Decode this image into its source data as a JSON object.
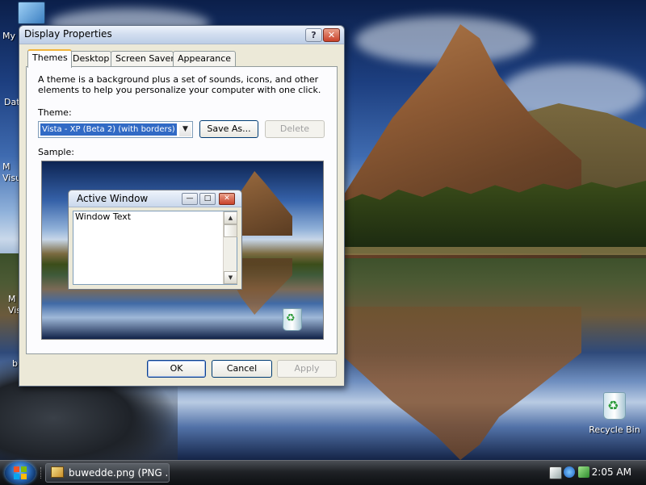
{
  "desktop": {
    "icons": [
      {
        "label": "My"
      },
      {
        "label": "Dat"
      },
      {
        "label": "M\nVisu"
      },
      {
        "label": "M\nVis"
      },
      {
        "label": "b"
      }
    ],
    "recycle_bin_label": "Recycle Bin"
  },
  "dialog": {
    "title": "Display Properties",
    "help_glyph": "?",
    "close_glyph": "✕",
    "tabs": [
      {
        "label": "Themes"
      },
      {
        "label": "Desktop"
      },
      {
        "label": "Screen Saver"
      },
      {
        "label": "Appearance"
      }
    ],
    "active_tab": "Themes",
    "description": "A theme is a background plus a set of sounds, icons, and other elements to help you personalize your computer with one click.",
    "theme_label": "Theme:",
    "theme_value": "Vista - XP (Beta 2) (with borders)",
    "save_as_label": "Save As...",
    "delete_label": "Delete",
    "sample_label": "Sample:",
    "preview": {
      "window_title": "Active Window",
      "window_text": "Window Text"
    },
    "ok_label": "OK",
    "cancel_label": "Cancel",
    "apply_label": "Apply"
  },
  "taskbar": {
    "task_label": "buwedde.png (PNG ...",
    "clock": "2:05 AM"
  }
}
